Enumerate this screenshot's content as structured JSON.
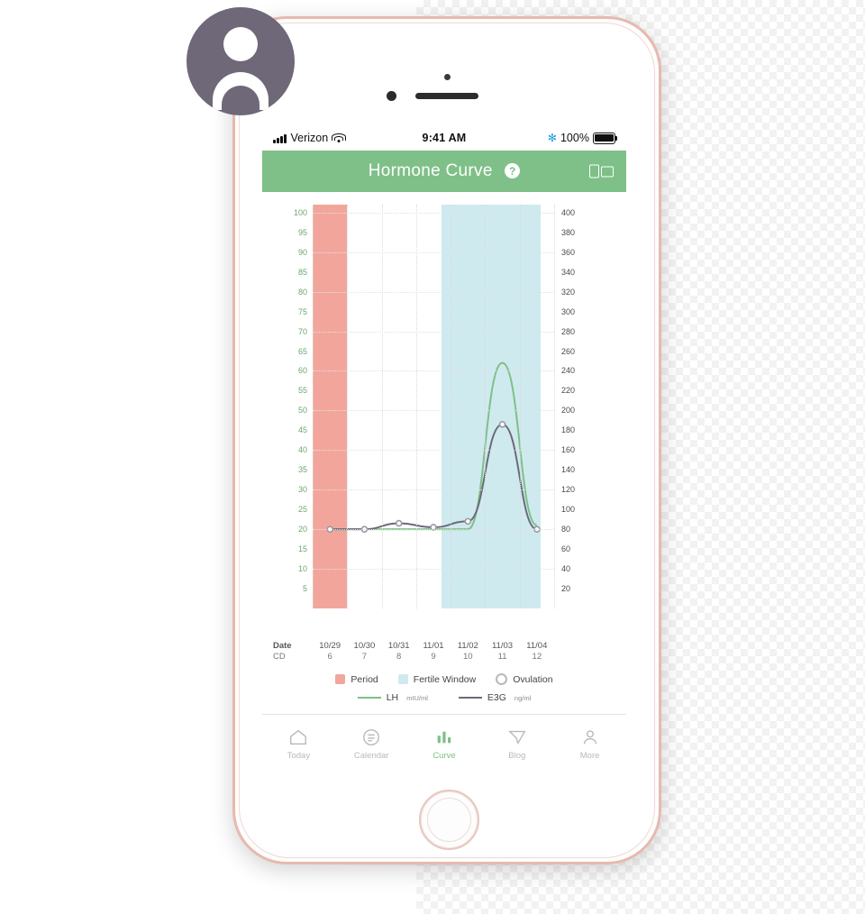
{
  "status_bar": {
    "carrier": "Verizon",
    "time": "9:41 AM",
    "battery_percent": "100%",
    "icons": {
      "signal": "signal-bars-icon",
      "wifi": "wifi-icon",
      "bluetooth": "bluetooth-icon",
      "battery": "battery-full-icon"
    }
  },
  "nav": {
    "title": "Hormone Curve",
    "help_label": "?",
    "right_icon": "compare-view-icon"
  },
  "chart_data": {
    "type": "line",
    "title": "Hormone Curve",
    "xlabel": "",
    "ylabel": "",
    "grid": true,
    "legend_position": "bottom",
    "x_axis": {
      "header_date": "Date",
      "header_cd": "CD",
      "dates": [
        "10/29",
        "10/30",
        "10/31",
        "11/01",
        "11/02",
        "11/03",
        "11/04"
      ],
      "cycle_days": [
        "6",
        "7",
        "8",
        "9",
        "10",
        "11",
        "12"
      ]
    },
    "left_axis": {
      "name": "LH",
      "unit": "mIU/ml",
      "color": "#7ec087",
      "ticks": [
        5,
        10,
        15,
        20,
        25,
        30,
        35,
        40,
        45,
        50,
        55,
        60,
        65,
        70,
        75,
        80,
        85,
        90,
        95,
        100
      ],
      "ylim": [
        0,
        102
      ]
    },
    "right_axis": {
      "name": "E3G",
      "unit": "ng/ml",
      "color": "#4a4a4a",
      "ticks": [
        20,
        40,
        60,
        80,
        100,
        120,
        140,
        160,
        180,
        200,
        220,
        240,
        260,
        280,
        300,
        320,
        340,
        360,
        380,
        400
      ],
      "ylim": [
        0,
        408
      ]
    },
    "series": [
      {
        "name": "LH",
        "unit": "mIU/ml",
        "color": "#7ec087",
        "axis": "left",
        "x": [
          "10/29",
          "10/30",
          "10/31",
          "11/01",
          "11/02",
          "11/03",
          "11/04"
        ],
        "values": [
          20,
          20,
          20,
          20,
          20,
          62,
          21
        ]
      },
      {
        "name": "E3G",
        "unit": "ng/ml",
        "color": "#6b6b78",
        "axis": "right",
        "x": [
          "10/29",
          "10/30",
          "10/31",
          "11/01",
          "11/02",
          "11/03",
          "11/04"
        ],
        "values": [
          80,
          80,
          86,
          82,
          88,
          186,
          80
        ]
      }
    ],
    "bands": [
      {
        "name": "Period",
        "color": "#f2a69b",
        "start": "10/29",
        "end": "10/29"
      },
      {
        "name": "Fertile Window",
        "color": "#cfeaef",
        "start": "11/01",
        "end": "11/03"
      }
    ],
    "markers": [
      {
        "name": "Ovulation",
        "color": "#ffffff",
        "border": "#b9b9b9"
      }
    ]
  },
  "legend": {
    "row1": [
      {
        "label": "Period",
        "type": "swatch",
        "color": "#f2a69b"
      },
      {
        "label": "Fertile Window",
        "type": "swatch",
        "color": "#cfeaef"
      },
      {
        "label": "Ovulation",
        "type": "dot",
        "color": "#ffffff"
      }
    ],
    "row2": [
      {
        "label": "LH",
        "unit": "mIU/ml",
        "type": "line",
        "color": "#7ec087"
      },
      {
        "label": "E3G",
        "unit": "ng/ml",
        "type": "line",
        "color": "#6b6b78"
      }
    ]
  },
  "tabbar": {
    "items": [
      {
        "label": "Today",
        "icon": "home-icon",
        "active": false
      },
      {
        "label": "Calendar",
        "icon": "calendar-icon",
        "active": false
      },
      {
        "label": "Curve",
        "icon": "bar-chart-icon",
        "active": true
      },
      {
        "label": "Blog",
        "icon": "paper-plane-icon",
        "active": false
      },
      {
        "label": "More",
        "icon": "person-icon",
        "active": false
      }
    ]
  },
  "avatar": {
    "icon": "user-avatar-icon"
  }
}
